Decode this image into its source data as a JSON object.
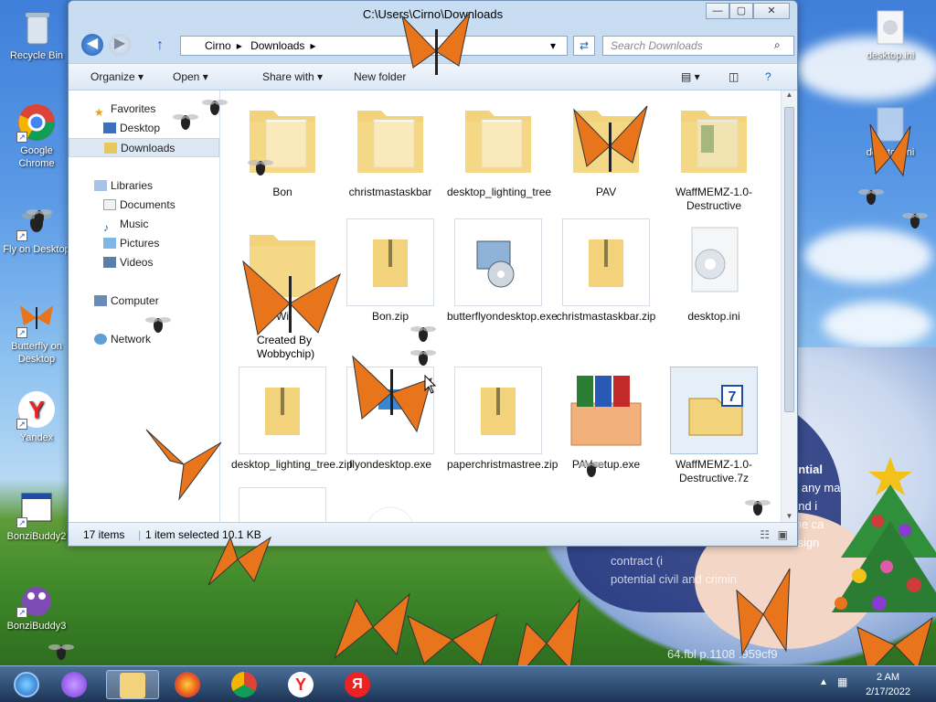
{
  "window": {
    "title": "C:\\Users\\Cirno\\Downloads",
    "minimize": "—",
    "maximize": "▢",
    "close": "✕"
  },
  "address": {
    "crumbs": [
      "Cirno",
      "Downloads"
    ],
    "refresh_icon": "refresh-icon",
    "search_placeholder": "Search Downloads"
  },
  "toolbar": {
    "organize": "Organize",
    "open": "Open",
    "share": "Share with",
    "new_folder": "New folder"
  },
  "navpane": {
    "favorites": "Favorites",
    "desktop": "Desktop",
    "downloads": "Downloads",
    "libraries": "Libraries",
    "documents": "Documents",
    "music": "Music",
    "pictures": "Pictures",
    "videos": "Videos",
    "computer": "Computer",
    "network": "Network"
  },
  "files": [
    {
      "name": "Bon",
      "type": "folder"
    },
    {
      "name": "christmastaskbar",
      "type": "folder"
    },
    {
      "name": "desktop_lighting_tree",
      "type": "folder"
    },
    {
      "name": "PAV",
      "type": "folder"
    },
    {
      "name": "WaffMEMZ-1.0-Destructive",
      "type": "folder"
    },
    {
      "name": "Wi",
      "type": "folder"
    },
    {
      "name": "Bon.zip",
      "type": "zip"
    },
    {
      "name": "butterflyondesktop.exe",
      "type": "exe"
    },
    {
      "name": "christmastaskbar.zip",
      "type": "zip"
    },
    {
      "name": "desktop.ini",
      "type": "ini"
    },
    {
      "name": "desktop_lighting_tree.zip",
      "type": "zip"
    },
    {
      "name": "flyondesktop.exe",
      "type": "exe"
    },
    {
      "name": "paperchristmastree.zip",
      "type": "zip"
    },
    {
      "name": "PAVsetup.exe",
      "type": "setup"
    },
    {
      "name": "WaffMEMZ-1.0-Destructive.7z",
      "type": "7z"
    }
  ],
  "partial_label": {
    "text": "Created By Wobbychip)"
  },
  "status": {
    "count": "17 items",
    "selected": "1 item selected  10.1 KB"
  },
  "desktop_icons": [
    {
      "label": "Recycle Bin"
    },
    {
      "label": "Google Chrome"
    },
    {
      "label": "Fly on Desktop"
    },
    {
      "label": "Butterfly on Desktop"
    },
    {
      "label": "Yandex"
    },
    {
      "label": "BonziBuddy2"
    },
    {
      "label": "BonziBuddy3"
    },
    {
      "label": "desktop.ini"
    },
    {
      "label": "desktop.ini"
    }
  ],
  "ransom": {
    "title": "ential",
    "l1": "n any ma",
    "l2": "and i",
    "l3": "the ca",
    "l4": "ssign",
    "low1": "contract (i",
    "low2": "potential civil and crimin",
    "hash": "64.fbl  p.1108  .959cf9"
  },
  "clock": {
    "time": "2 AM",
    "date": "2/17/2022"
  },
  "colors": {
    "folder": "#f2d27a",
    "butterfly": "#e8741c",
    "taskbar": "#1d3556"
  }
}
